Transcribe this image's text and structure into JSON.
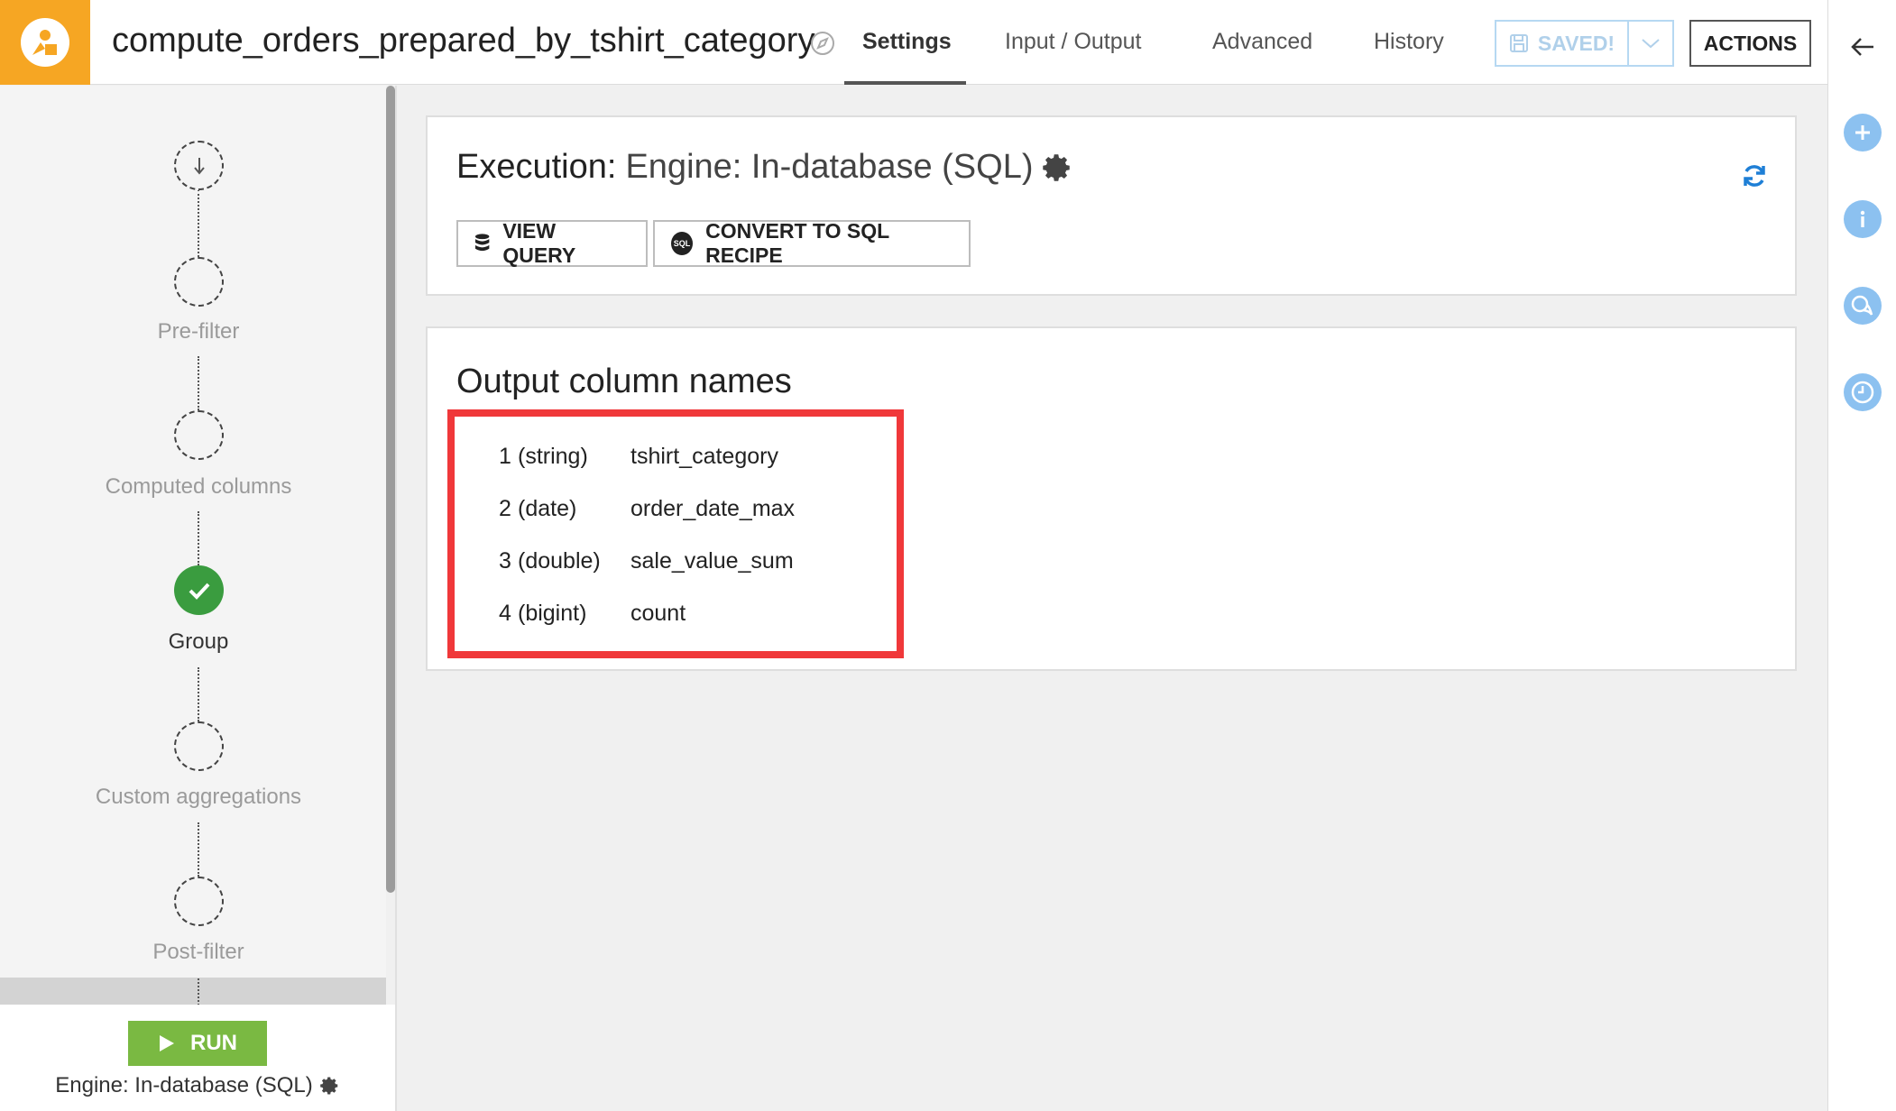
{
  "header": {
    "recipe_name": "compute_orders_prepared_by_tshirt_category",
    "tabs": [
      {
        "label": "Settings",
        "active": true
      },
      {
        "label": "Input / Output",
        "active": false
      },
      {
        "label": "Advanced",
        "active": false
      },
      {
        "label": "History",
        "active": false
      }
    ],
    "saved_label": "SAVED!",
    "actions_label": "ACTIONS"
  },
  "sidebar": {
    "steps": [
      {
        "label": ""
      },
      {
        "label": "Pre-filter"
      },
      {
        "label": "Computed columns"
      },
      {
        "label": "Group"
      },
      {
        "label": "Custom aggregations"
      },
      {
        "label": "Post-filter"
      }
    ],
    "run_label": "RUN",
    "engine_label": "Engine: In-database (SQL)"
  },
  "execution": {
    "title_prefix": "Execution:",
    "engine": "Engine: In-database (SQL)",
    "view_query_label": "VIEW QUERY",
    "convert_label": "CONVERT TO SQL RECIPE",
    "sql_badge": "SQL"
  },
  "output": {
    "title": "Output column names",
    "columns": [
      {
        "index": "1",
        "type": "(string)",
        "name": "tshirt_category"
      },
      {
        "index": "2",
        "type": "(date)",
        "name": "order_date_max"
      },
      {
        "index": "3",
        "type": "(double)",
        "name": "sale_value_sum"
      },
      {
        "index": "4",
        "type": "(bigint)",
        "name": "count"
      }
    ]
  },
  "colors": {
    "brand": "#f6a623",
    "run": "#7ab942",
    "done": "#3a9c3f",
    "highlight": "#f0383a",
    "rail_icon": "#8cc1f0"
  }
}
